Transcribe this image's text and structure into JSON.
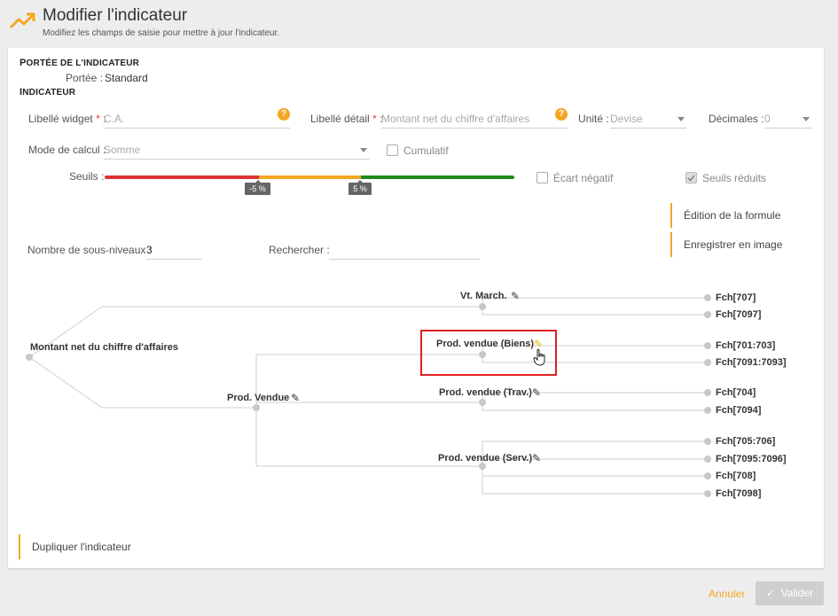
{
  "header": {
    "title": "Modifier l'indicateur",
    "subtitle": "Modifiez les champs de saisie pour mettre à jour l'indicateur."
  },
  "scope": {
    "section_title_cap": "P",
    "section_title_rest": "ORTÉE DE L'INDICATEUR",
    "label": "Portée :",
    "value": "Standard"
  },
  "indicator": {
    "section_title_cap": "I",
    "section_title_rest": "NDICATEUR",
    "libelle_widget": {
      "label": "Libellé widget",
      "required": "*",
      "colon": ":",
      "placeholder": "C.A."
    },
    "libelle_detail": {
      "label": "Libellé détail",
      "required": "*",
      "colon": ":",
      "placeholder": "Montant net du chiffre d'affaires"
    },
    "unite": {
      "label": "Unité :",
      "value": "Devise"
    },
    "decimales": {
      "label": "Décimales :",
      "value": "0"
    },
    "mode_calcul": {
      "label": "Mode de calcul :",
      "value": "Somme"
    },
    "cumulatif": {
      "label": "Cumulatif",
      "checked": false
    },
    "seuils": {
      "label": "Seuils :",
      "low": "-5 %",
      "high": "5 %",
      "colors": {
        "red": "#dd3333",
        "orange": "#f5a623",
        "green": "#1e8a1e"
      }
    },
    "ecart_negatif": {
      "label": "Écart négatif",
      "checked": false
    },
    "seuils_reduits": {
      "label": "Seuils réduits",
      "checked": true
    },
    "help_glyph": "?"
  },
  "actions": {
    "edit_formula": "Édition de la formule",
    "save_image": "Enregistrer en image",
    "duplicate": "Dupliquer l'indicateur"
  },
  "levels": {
    "label": "Nombre de sous-niveaux :",
    "value": "3"
  },
  "search": {
    "label": "Rechercher :",
    "value": ""
  },
  "tree": {
    "root": "Montant net du chiffre d'affaires",
    "vt_march": "Vt. March.",
    "prod_vendue": "Prod. Vendue",
    "prod_biens": "Prod. vendue (Biens)",
    "prod_trav": "Prod. vendue (Trav.)",
    "prod_serv": "Prod. vendue (Serv.)",
    "leaves": {
      "l707": "Fch[707]",
      "l7097": "Fch[7097]",
      "l701_703": "Fch[701:703]",
      "l7091_7093": "Fch[7091:7093]",
      "l704": "Fch[704]",
      "l7094": "Fch[7094]",
      "l705_706": "Fch[705:706]",
      "l7095_7096": "Fch[7095:7096]",
      "l708": "Fch[708]",
      "l7098": "Fch[7098]"
    }
  },
  "footer": {
    "cancel": "Annuler",
    "validate": "Valider"
  },
  "theme": {
    "accent": "#f5a623",
    "highlight": "#e02020"
  }
}
